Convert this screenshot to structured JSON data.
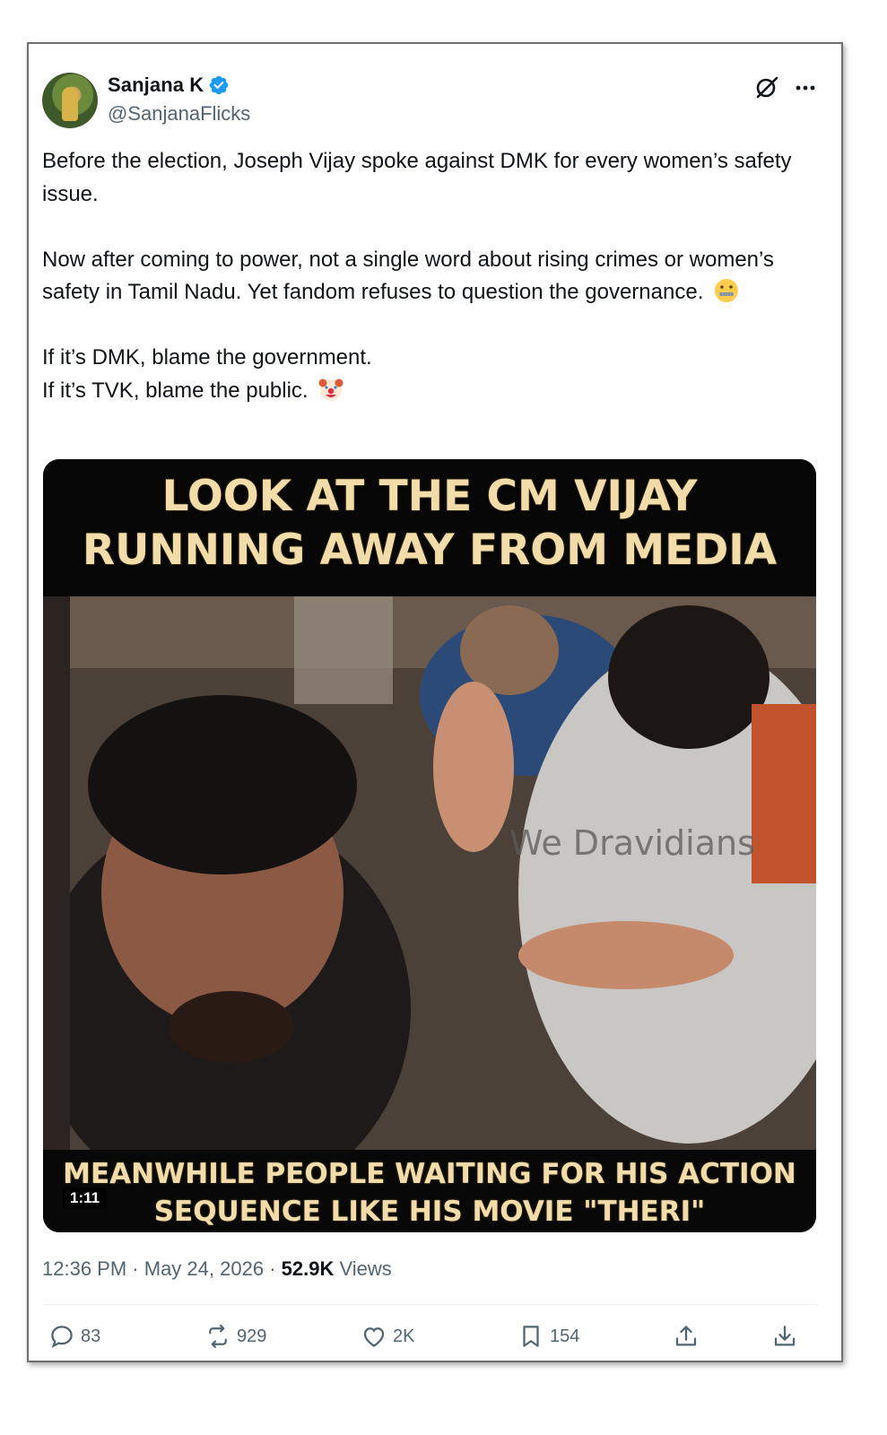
{
  "author": {
    "display_name": "Sanjana K",
    "handle": "@SanjanaFlicks",
    "verified": true
  },
  "tweet": {
    "paragraphs": [
      "Before the election, Joseph Vijay spoke against DMK for every women’s safety issue.",
      "Now after coming to power, not a single word about rising crimes or women’s safety in Tamil Nadu. Yet fandom refuses to question the governance.",
      "If it’s DMK, blame the government.",
      "If it’s TVK, blame the public."
    ]
  },
  "media": {
    "headline_line1": "LOOK AT THE CM VIJAY",
    "headline_line2": "RUNNING AWAY FROM MEDIA",
    "caption_line1": "MEANWHILE PEOPLE WAITING FOR HIS ACTION",
    "caption_line2": "SEQUENCE LIKE HIS MOVIE \"THERI\"",
    "watermark": "We Dravidians",
    "duration": "1:11"
  },
  "meta": {
    "time": "12:36 PM",
    "date": "May 24, 2026",
    "views_count": "52.9K",
    "views_label": "Views",
    "separator": "·"
  },
  "actions": {
    "replies": "83",
    "reposts": "929",
    "likes": "2K",
    "bookmarks": "154"
  },
  "icons": [
    "verified-badge-icon",
    "grok-icon",
    "more-icon",
    "reply-icon",
    "repost-icon",
    "like-icon",
    "bookmark-icon",
    "share-icon",
    "download-icon",
    "zipper-mouth-emoji",
    "clown-emoji"
  ],
  "colors": {
    "text": "#0f1419",
    "secondary": "#536471",
    "verified_blue": "#1d9bf0",
    "overlay_text": "#f1dcaa"
  }
}
